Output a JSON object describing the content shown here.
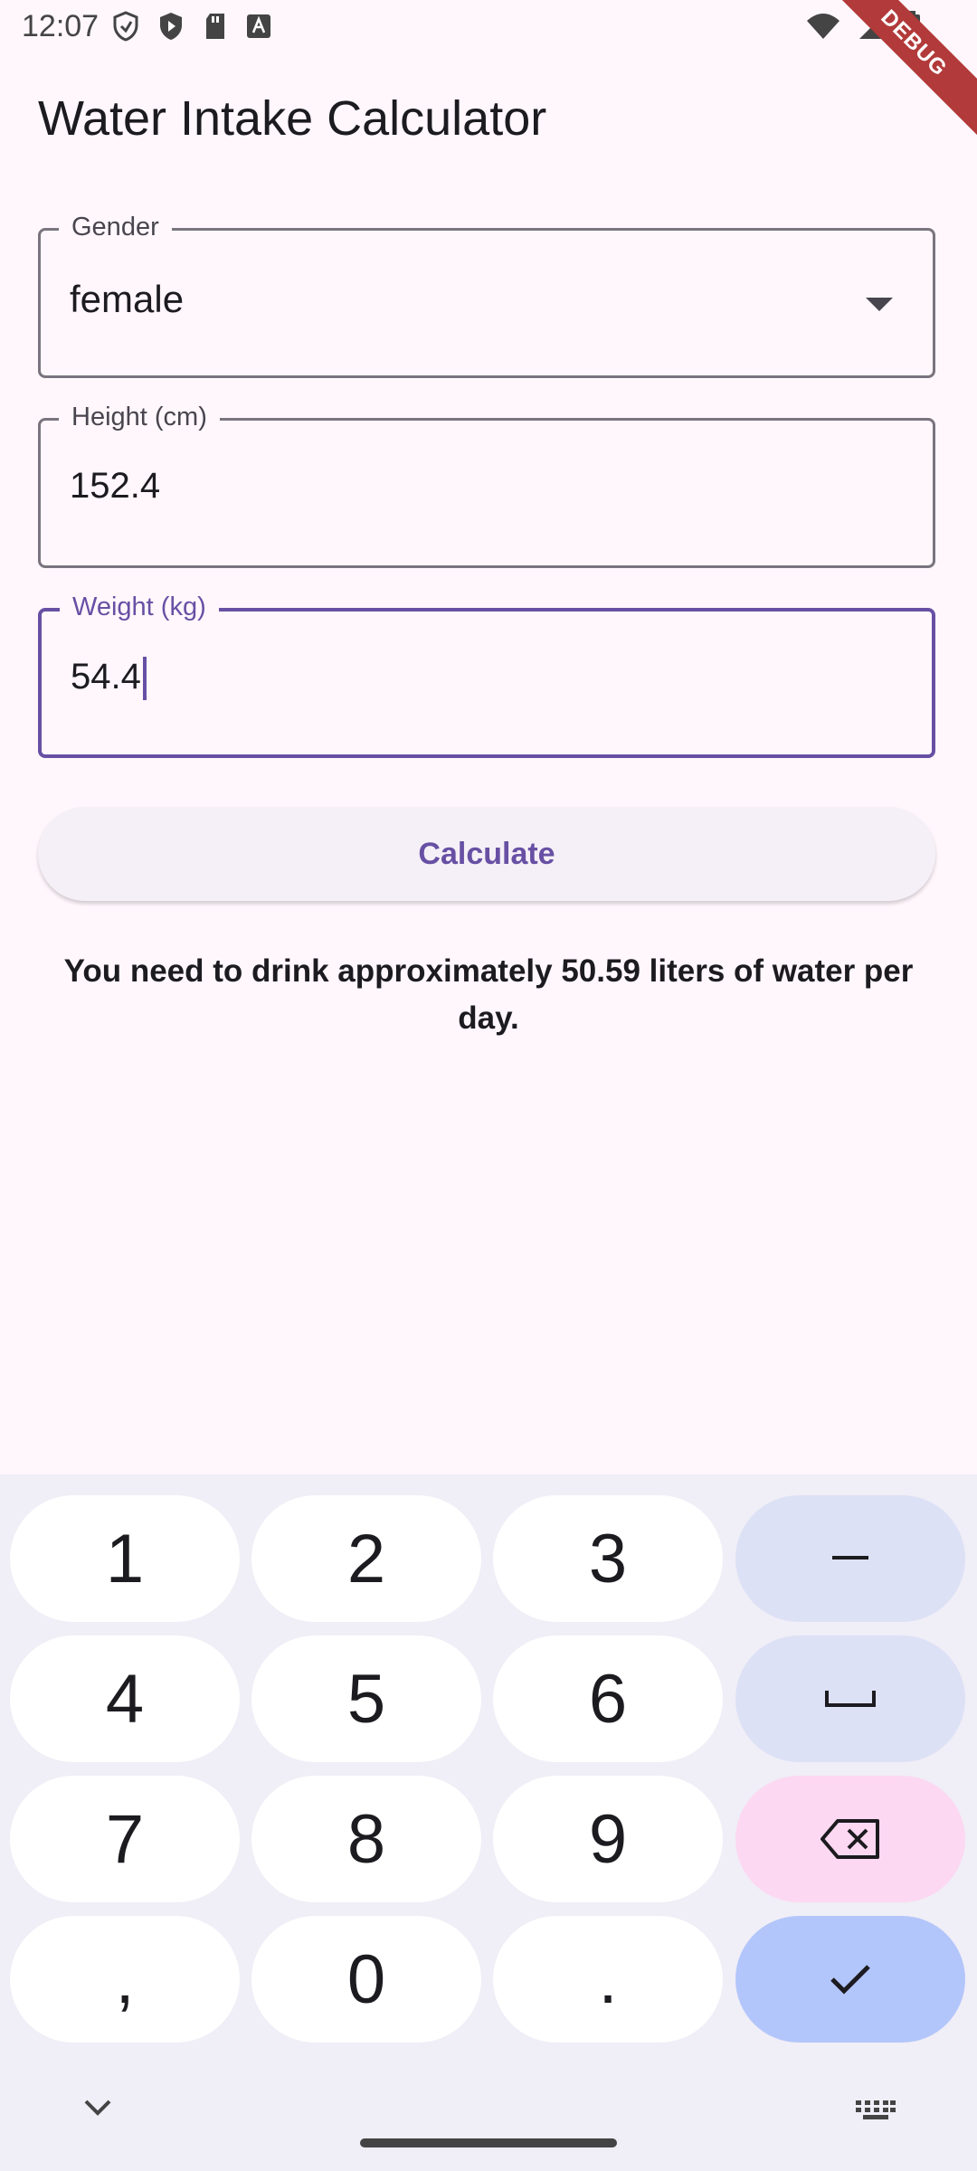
{
  "status_bar": {
    "time": "12:07",
    "left_icons": [
      "shield-icon",
      "play-protect-icon",
      "sd-card-icon",
      "font-icon"
    ],
    "right_icons": [
      "wifi-icon",
      "signal-icon",
      "battery-icon"
    ],
    "debug_label": "DEBUG"
  },
  "app": {
    "title": "Water Intake Calculator"
  },
  "form": {
    "gender": {
      "label": "Gender",
      "value": "female"
    },
    "height": {
      "label": "Height (cm)",
      "value": "152.4"
    },
    "weight": {
      "label": "Weight (kg)",
      "value": "54.4"
    },
    "calculate_label": "Calculate"
  },
  "result": {
    "text": "You need to drink approximately 50.59 liters of water per day."
  },
  "keyboard": {
    "keys": [
      "1",
      "2",
      "3",
      "–",
      "4",
      "5",
      "6",
      "␣",
      "7",
      "8",
      "9",
      "⌫",
      ",",
      "0",
      ".",
      "✓"
    ]
  },
  "colors": {
    "accent": "#6750A4",
    "background": "#FFF7FC",
    "keyboard_bg": "#F0EEF6",
    "key_func": "#DDE1F6",
    "key_backspace": "#FCD8F2",
    "key_enter": "#B3C6FB"
  }
}
